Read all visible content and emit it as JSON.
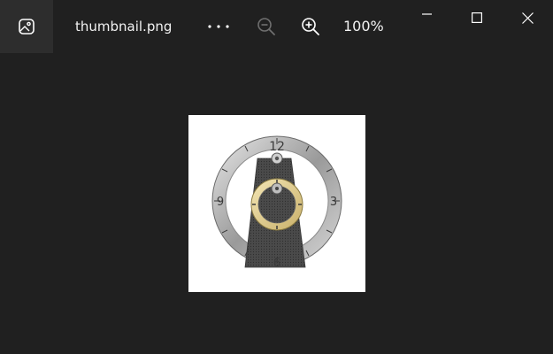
{
  "window": {
    "app_icon": "photos-app-icon",
    "filename": "thumbnail.png",
    "zoom_level": "100%",
    "controls": [
      "minimize-icon",
      "maximize-icon",
      "close-icon"
    ]
  },
  "toolbar": {
    "more_icon": "more-icon",
    "zoom_out_icon": "zoom-out-icon",
    "zoom_in_icon": "zoom-in-icon"
  },
  "image": {
    "subject": "clock-face",
    "numerals": [
      "12",
      "3",
      "6",
      "9"
    ],
    "colors": {
      "ring": "#b4b4b4",
      "accent_ring": "#e7d7a0",
      "panel": "#4a4a4a",
      "background": "#ffffff"
    }
  }
}
